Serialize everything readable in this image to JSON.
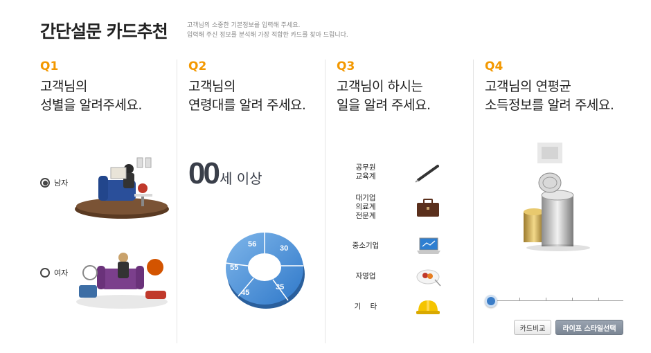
{
  "header": {
    "title": "간단설문 카드추천",
    "desc_line1": "고객님의 소중한 기본정보를 입력해 주세요.",
    "desc_line2": "입력해 주신 정보를 분석해 가장 적합한 카드를 찾아 드립니다."
  },
  "q1": {
    "num": "Q1",
    "line1": "고객님의",
    "line2": "성별을 알려주세요.",
    "options": [
      {
        "label": "남자",
        "selected": true
      },
      {
        "label": "여자",
        "selected": false
      }
    ]
  },
  "q2": {
    "num": "Q2",
    "line1": "고객님의",
    "line2": "연령대를 알려 주세요.",
    "age_value": "00",
    "age_suffix": "세 이상",
    "donut_labels": [
      "30",
      "35",
      "45",
      "55",
      "56"
    ],
    "donut_color": "#4a90d9"
  },
  "q3": {
    "num": "Q3",
    "line1": "고객님이 하시는",
    "line2": "일을 알려 주세요.",
    "jobs": [
      {
        "line1": "공무원",
        "line2": "교육계",
        "line3": "",
        "icon": "pen-icon"
      },
      {
        "line1": "대기업",
        "line2": "의료계",
        "line3": "전문계",
        "icon": "briefcase-icon"
      },
      {
        "line1": "중소기업",
        "line2": "",
        "line3": "",
        "icon": "laptop-icon"
      },
      {
        "line1": "자영업",
        "line2": "",
        "line3": "",
        "icon": "food-plate-icon"
      },
      {
        "line1": "기    타",
        "line2": "",
        "line3": "",
        "icon": "hardhat-icon"
      }
    ]
  },
  "q4": {
    "num": "Q4",
    "line1": "고객님의 연평균",
    "line2": "소득정보를 알려 주세요.",
    "slider_value": 0,
    "buttons": {
      "compare": "카드비교",
      "lifestyle": "라이프 스타일선택"
    }
  },
  "colors": {
    "accent": "#f39800",
    "slider": "#3b7dc7"
  }
}
